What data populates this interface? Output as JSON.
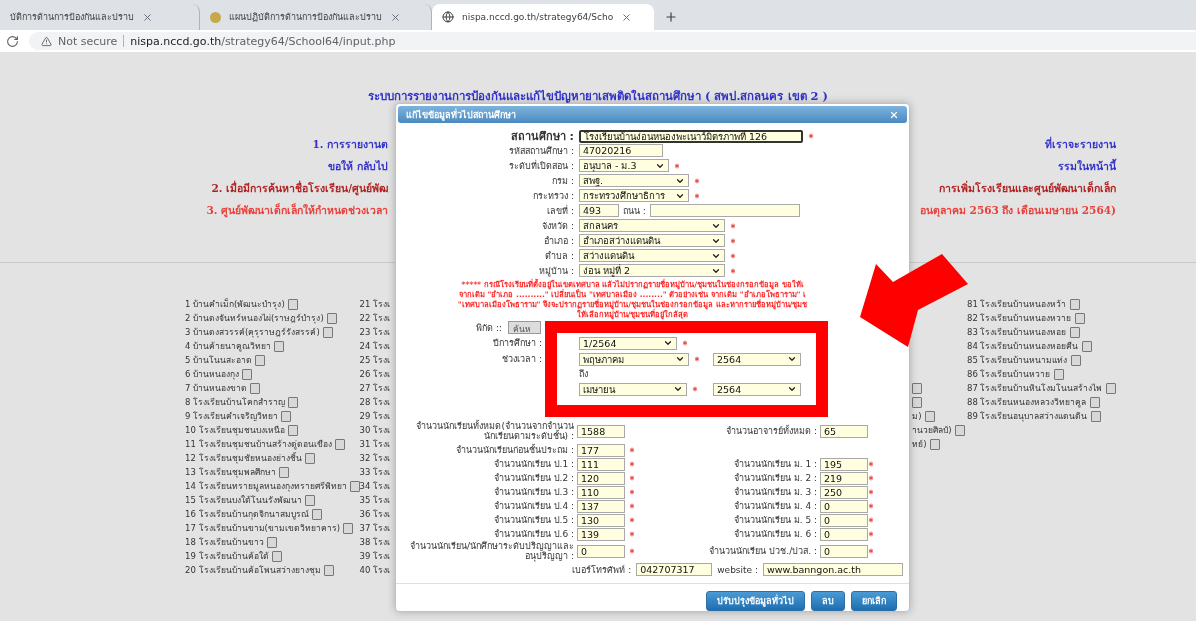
{
  "browser": {
    "tabs": [
      {
        "title": "บัติการด้านการป้องกันและปราบ",
        "selected": false
      },
      {
        "title": "แผนปฏิบัติการด้านการป้องกันและปราบ",
        "selected": false
      },
      {
        "title": "nispa.nccd.go.th/strategy64/Scho",
        "selected": true
      }
    ],
    "security": "Not secure",
    "host": "nispa.nccd.go.th",
    "path": "/strategy64/School64/input.php"
  },
  "page": {
    "title": "ระบบการรายงานการป้องกันและแก้ไขปัญหายาเสพติดในสถานศึกษา ( สพป.สกลนคร เขต 2 )",
    "notices": [
      {
        "left": "1. การรายงานต",
        "right": "ที่เราจะรายงาน",
        "color": "#3333cc"
      },
      {
        "left": "ขอให้ กลับไป",
        "right": "รรมในหน้านี้",
        "color": "#3333cc"
      },
      {
        "left": "2. เมื่อมีการค้นหาชื่อโรงเรียน/ศูนย์พัฒ",
        "right": "การเพิ่มโรงเรียนและศูนย์พัฒนาเด็กเล็ก",
        "color": "#b22222"
      },
      {
        "left": "3. ศูนย์พัฒนาเด็กเล็กให้กำหนดช่วงเวลา",
        "right": "อนตุลาคม 2563 ถึง เดือนเมษายน 2564)",
        "color": "#e8413c"
      }
    ],
    "school_columns": [
      [
        {
          "text": "1 บ้านคำเม็ก(พัฒนะบำรุง)",
          "icon": true
        },
        {
          "text": "2 บ้านดงจันทร์หนองไผ่(ราษฎร์บำรุง)",
          "icon": true
        },
        {
          "text": "3 บ้านดงสวรรค์(คุรุราษฎร์รังสรรค์)",
          "icon": true
        },
        {
          "text": "4 บ้านค้ายนาคูณวิทยา",
          "icon": true
        },
        {
          "text": "5 บ้านโนนสะอาด",
          "icon": true
        },
        {
          "text": "6 บ้านหนองกุง",
          "icon": true
        },
        {
          "text": "7 บ้านหนองขาด",
          "icon": true
        },
        {
          "text": "8 โรงเรียนบ้านโคกสำราญ",
          "icon": true
        },
        {
          "text": "9 โรงเรียนคำเจริญวิทยา",
          "icon": true
        },
        {
          "text": "10 โรงเรียนชุมชนบงเหนือ",
          "icon": true
        },
        {
          "text": "11 โรงเรียนชุมชนบ้านสร้างดู่ดอนเขือง",
          "icon": true
        },
        {
          "text": "12 โรงเรียนชุมชัยหนองย่างชิ้น",
          "icon": true
        },
        {
          "text": "13 โรงเรียนชุมพลศึกษา",
          "icon": true
        },
        {
          "text": "14 โรงเรียนทรายมูลหนองกุงทรายศรีพิทยา",
          "icon": true
        },
        {
          "text": "15 โรงเรียนบงใต้โนนรังพัฒนา",
          "icon": true
        },
        {
          "text": "16 โรงเรียนบ้านกุดจิกนาสมบูรณ์",
          "icon": true
        },
        {
          "text": "17 โรงเรียนบ้านขาม(ขามเขตวิทยาคาร)",
          "icon": true
        },
        {
          "text": "18 โรงเรียนบ้านขาว",
          "icon": true
        },
        {
          "text": "19 โรงเรียนบ้านค้อใต้",
          "icon": true
        },
        {
          "text": "20 โรงเรียนบ้านค้อโพนสว่างยางชุม",
          "icon": true
        }
      ],
      [
        {
          "text": "21 โรงเ",
          "icon": false
        },
        {
          "text": "22 โรงเ",
          "icon": false
        },
        {
          "text": "23 โรงเ",
          "icon": false
        },
        {
          "text": "24 โรงเ",
          "icon": false
        },
        {
          "text": "25 โรงเ",
          "icon": false
        },
        {
          "text": "26 โรงเ",
          "icon": false
        },
        {
          "text": "27 โรงเ",
          "icon": false
        },
        {
          "text": "28 โรงเ",
          "icon": false
        },
        {
          "text": "29 โรงเ",
          "icon": false
        },
        {
          "text": "30 โรงเ",
          "icon": false
        },
        {
          "text": "31 โรงเ",
          "icon": false
        },
        {
          "text": "32 โรงเ",
          "icon": false
        },
        {
          "text": "33 โรงเ",
          "icon": false
        },
        {
          "text": "34 โรงเ",
          "icon": false
        },
        {
          "text": "35 โรงเ",
          "icon": false
        },
        {
          "text": "36 โรงเ",
          "icon": false
        },
        {
          "text": "37 โรงเ",
          "icon": false
        },
        {
          "text": "38 โรงเ",
          "icon": false
        },
        {
          "text": "39 โรงเ",
          "icon": false
        },
        {
          "text": "40 โรงเ",
          "icon": false
        }
      ],
      [
        {
          "icon": true
        },
        {
          "icon": true
        },
        {
          "text": "ม)",
          "icon": true
        },
        {
          "text": "านวยศิลป์)",
          "icon": true
        },
        {
          "text": "ทย์)",
          "icon": true
        }
      ],
      [
        {
          "text": "81 โรงเรียนบ้านหนองหว้า",
          "icon": true
        },
        {
          "text": "82 โรงเรียนบ้านหนองหวาย",
          "icon": true
        },
        {
          "text": "83 โรงเรียนบ้านหนองหอย",
          "icon": true
        },
        {
          "text": "84 โรงเรียนบ้านหนองหอยคืน",
          "icon": true
        },
        {
          "text": "85 โรงเรียนบ้านหนามแท่ง",
          "icon": true
        },
        {
          "text": "86 โรงเรียนบ้านหวาย",
          "icon": true
        },
        {
          "text": "87 โรงเรียนบ้านหินโงมโนนสร้างไพ",
          "icon": true
        },
        {
          "text": "88 โรงเรียนหนองหลวงวิทยาคูล",
          "icon": true
        },
        {
          "text": "89 โรงเรียนอนุบาลสว่างแดนดิน",
          "icon": true
        }
      ]
    ]
  },
  "dialog": {
    "title": "แก้ไขข้อมูลทั่วไปสถานศึกษา",
    "fields": [
      {
        "kind": "main",
        "label": "สถานศึกษา :",
        "value": "โรงเรียนบ้านง่อนหนองพะเนาว์มิตรภาพที่  126",
        "required": true
      },
      {
        "kind": "text",
        "label": "รหัสสถานศึกษา :",
        "value": "47020216",
        "required": false
      },
      {
        "kind": "select",
        "label": "ระดับที่เปิดสอน :",
        "value": "อนุบาล - ม.3",
        "required": true
      },
      {
        "kind": "select",
        "label": "กรม :",
        "value": "สพฐ.",
        "required": true
      },
      {
        "kind": "select",
        "label": "กระทรวง :",
        "value": "กระทรวงศึกษาธิการ",
        "required": true
      },
      {
        "kind": "pair",
        "label": "เลขที่ :",
        "value": "493",
        "label2": "ถนน :",
        "required": false
      },
      {
        "kind": "select",
        "label": "จังหวัด :",
        "value": "สกลนคร",
        "required": true
      },
      {
        "kind": "select",
        "label": "อำเภอ :",
        "value": "อำเภอสว่างแดนดิน",
        "required": true
      },
      {
        "kind": "select",
        "label": "ตำบล :",
        "value": "สว่างแดนดิน",
        "required": true
      },
      {
        "kind": "select",
        "label": "หมู่บ้าน :",
        "value": "ง่อน หมู่ที่ 2",
        "required": true
      }
    ],
    "note": [
      "***** กรณีโรงเรียนที่ตั้งอยู่ในเขตเทศบาล แล้วไม่ปรากฏรายชื่อหมู่บ้าน/ชุมชนในช่องกรอกข้อมูล ขอให้เ",
      "จากเดิม \"อำเภอ ..........\" เปลี่ยนเป็น \"เทศบาลเมือง ........\" ตัวอย่างเช่น จากเดิม \"อำเภอโพธาราม\" เ",
      "\"เทศบาลเมืองโพธาราม\" จึงจะปรากฏรายชื่อหมู่บ้าน/ชุมชนในช่องกรอกข้อมูล และหากรายชื่อหมู่บ้าน/ชุมช",
      "ให้เลือกหมู่บ้าน/ชุมชนที่อยู่ใกล้สุด"
    ],
    "coords": {
      "label": "พิกัด ::",
      "button": "ค้นห"
    },
    "period": [
      {
        "kind": "selects",
        "label": "ปีการศึกษา :",
        "selects": [
          {
            "value": "1/2564",
            "required": true
          }
        ]
      },
      {
        "kind": "selects",
        "label": "ช่วงเวลา :",
        "selects": [
          {
            "value": "พฤษภาคม",
            "required": true
          },
          {
            "value": "2564",
            "required": false
          }
        ]
      },
      {
        "kind": "caption",
        "label": "ถึง"
      },
      {
        "kind": "selects",
        "selects": [
          {
            "value": "เมษายน",
            "required": true
          },
          {
            "value": "2564",
            "required": false
          }
        ]
      }
    ],
    "total": {
      "label": "จำนวนนักเรียนทั้งหมด(จำนวนจากจำนวนนักเรียนตามระดับชั้น) :",
      "value": "1588",
      "required": false
    },
    "teachers": {
      "label": "จำนวนอาจารย์ทั้งหมด :",
      "value": "65",
      "required": false
    },
    "preschool": {
      "label": "จำนวนนักเรียนก่อนชั้นประถม :",
      "value": "177",
      "required": true
    },
    "grades": [
      {
        "left": {
          "label": "จำนวนนักเรียน ป.1 :",
          "value": "111",
          "required": true
        },
        "right": {
          "label": "จำนวนนักเรียน ม. 1 :",
          "value": "195",
          "required": true
        }
      },
      {
        "left": {
          "label": "จำนวนนักเรียน ป.2 :",
          "value": "120",
          "required": true
        },
        "right": {
          "label": "จำนวนนักเรียน ม. 2 :",
          "value": "219",
          "required": true
        }
      },
      {
        "left": {
          "label": "จำนวนนักเรียน ป.3 :",
          "value": "110",
          "required": true
        },
        "right": {
          "label": "จำนวนนักเรียน ม. 3 :",
          "value": "250",
          "required": true
        }
      },
      {
        "left": {
          "label": "จำนวนนักเรียน ป.4 :",
          "value": "137",
          "required": true
        },
        "right": {
          "label": "จำนวนนักเรียน ม. 4 :",
          "value": "0",
          "required": true
        }
      },
      {
        "left": {
          "label": "จำนวนนักเรียน ป.5 :",
          "value": "130",
          "required": true
        },
        "right": {
          "label": "จำนวนนักเรียน ม. 5 :",
          "value": "0",
          "required": true
        }
      },
      {
        "left": {
          "label": "จำนวนนักเรียน ป.6 :",
          "value": "139",
          "required": true
        },
        "right": {
          "label": "จำนวนนักเรียน ม. 6 :",
          "value": "0",
          "required": true
        }
      },
      {
        "left": {
          "label": "จำนวนนักเรียน/นักศึกษาระดับปริญญาและอนุปริญญา :",
          "value": "0",
          "required": true
        },
        "right": {
          "label": "จำนวนนักเรียน ปวช./ปวส. :",
          "value": "0",
          "required": true
        }
      }
    ],
    "phone": {
      "label": "เบอร์โทรศัพท์ :",
      "value": "042707317"
    },
    "website": {
      "label": "website :",
      "value": "www.banngon.ac.th"
    },
    "buttons": [
      "ปรับปรุงข้อมูลทั่วไป",
      "ลบ",
      "ยกเลิก"
    ]
  }
}
